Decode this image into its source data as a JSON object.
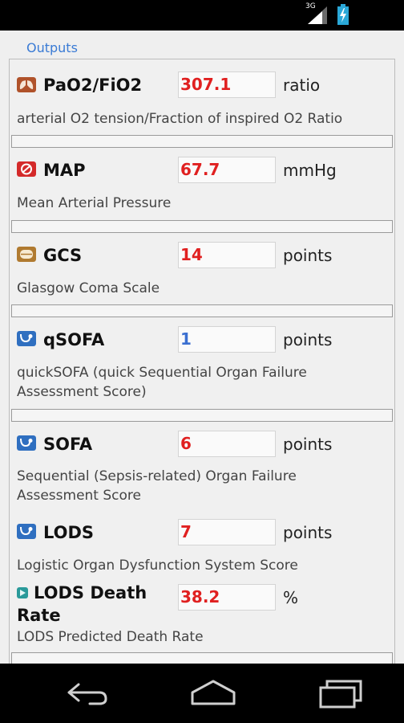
{
  "status_bar": {
    "network_label": "3G",
    "icons": [
      "signal-icon",
      "battery-charging-icon"
    ]
  },
  "outputs": {
    "title": "Outputs",
    "items": [
      {
        "icon": "lungs-icon",
        "icon_color": "#b0522a",
        "title": "PaO2/FiO2",
        "value": "307.1",
        "value_color": "#e02020",
        "unit": "ratio",
        "description": "arterial O2 tension/Fraction of inspired O2 Ratio"
      },
      {
        "icon": "heart-pressure-icon",
        "icon_color": "#d42a2a",
        "title": "MAP",
        "value": "67.7",
        "value_color": "#e02020",
        "unit": "mmHg",
        "description": "Mean Arterial Pressure"
      },
      {
        "icon": "brain-icon",
        "icon_color": "#b07a30",
        "title": "GCS",
        "value": "14",
        "value_color": "#e02020",
        "unit": "points",
        "description": "Glasgow Coma Scale"
      },
      {
        "icon": "stethoscope-icon",
        "icon_color": "#2f6fc0",
        "title": "qSOFA",
        "value": "1",
        "value_color": "#3a6fd0",
        "unit": "points",
        "description_line1": "quickSOFA (quick Sequential Organ Failure",
        "description_line2": "Assessment Score)"
      },
      {
        "icon": "stethoscope-icon",
        "icon_color": "#2f6fc0",
        "title": "SOFA",
        "value": "6",
        "value_color": "#e02020",
        "unit": "points",
        "description_line1": "Sequential (Sepsis-related) Organ Failure",
        "description_line2": "Assessment Score"
      },
      {
        "icon": "stethoscope-icon",
        "icon_color": "#2f6fc0",
        "title": "LODS",
        "value": "7",
        "value_color": "#e02020",
        "unit": "points",
        "description": "Logistic Organ Dysfunction System Score"
      },
      {
        "icon": "chart-icon",
        "icon_color": "#2a9a9a",
        "title_line1": "LODS Death",
        "title_line2": "Rate",
        "value": "38.2",
        "value_color": "#e02020",
        "unit": "%",
        "description": "LODS Predicted Death Rate"
      }
    ]
  },
  "nav_bar": {
    "buttons": [
      "back-icon",
      "home-icon",
      "recent-apps-icon"
    ]
  }
}
